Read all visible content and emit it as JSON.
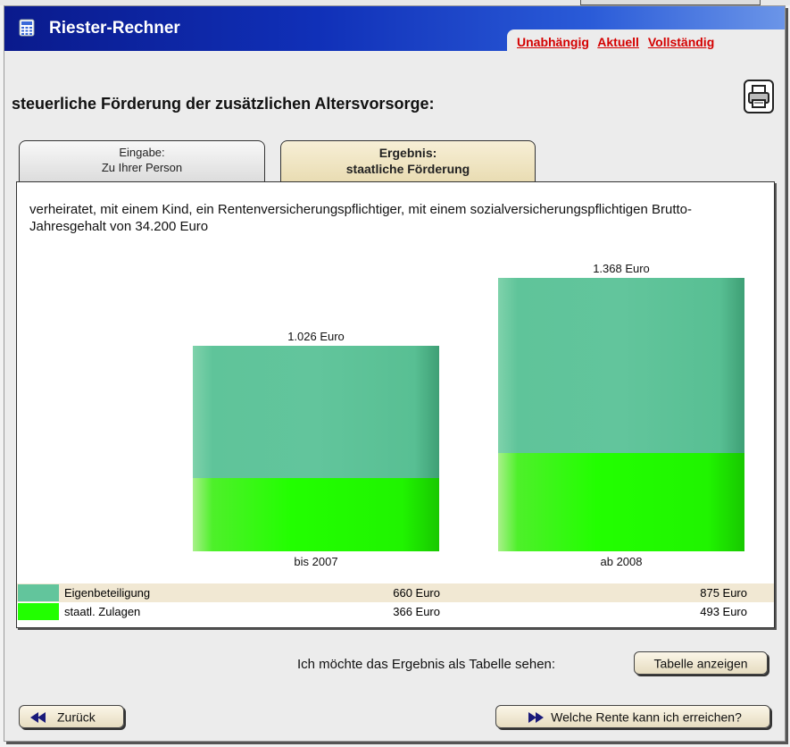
{
  "app": {
    "title": "Riester-Rechner"
  },
  "nav": {
    "links": [
      "Unabhängig",
      "Aktuell",
      "Vollständig"
    ]
  },
  "heading": "steuerliche Förderung der zusätzlichen Altersvorsorge:",
  "tabs": [
    {
      "line1": "Eingabe:",
      "line2": "Zu Ihrer Person",
      "active": false
    },
    {
      "line1": "Ergebnis:",
      "line2": "staatliche Förderung",
      "active": true
    }
  ],
  "description": "verheiratet, mit einem Kind, ein Rentenversicherungspflichtiger, mit einem sozialversicherungspflichtigen Brutto-Jahresgehalt von 34.200 Euro",
  "chart_data": {
    "type": "bar",
    "stacked": true,
    "categories": [
      "bis 2007",
      "ab 2008"
    ],
    "series": [
      {
        "name": "staatl. Zulagen",
        "values": [
          366,
          493
        ],
        "color": "#22ff00"
      },
      {
        "name": "Eigenbeteiligung",
        "values": [
          660,
          875
        ],
        "color": "#62c59c"
      }
    ],
    "totals": [
      "1.026 Euro",
      "1.368 Euro"
    ]
  },
  "legend": [
    {
      "label": "Eigenbeteiligung",
      "v1": "660 Euro",
      "v2": "875 Euro",
      "color": "#62c59c"
    },
    {
      "label": "staatl. Zulagen",
      "v1": "366 Euro",
      "v2": "493 Euro",
      "color": "#22ff00"
    }
  ],
  "table_prompt": "Ich möchte das Ergebnis als Tabelle sehen:",
  "buttons": {
    "table": "Tabelle anzeigen",
    "back": "Zurück",
    "next": "Welche Rente kann ich erreichen?"
  },
  "icons": {
    "app": "calculator-icon",
    "print": "printer-icon",
    "back": "arrow-left-icon",
    "next": "arrow-right-icon"
  }
}
